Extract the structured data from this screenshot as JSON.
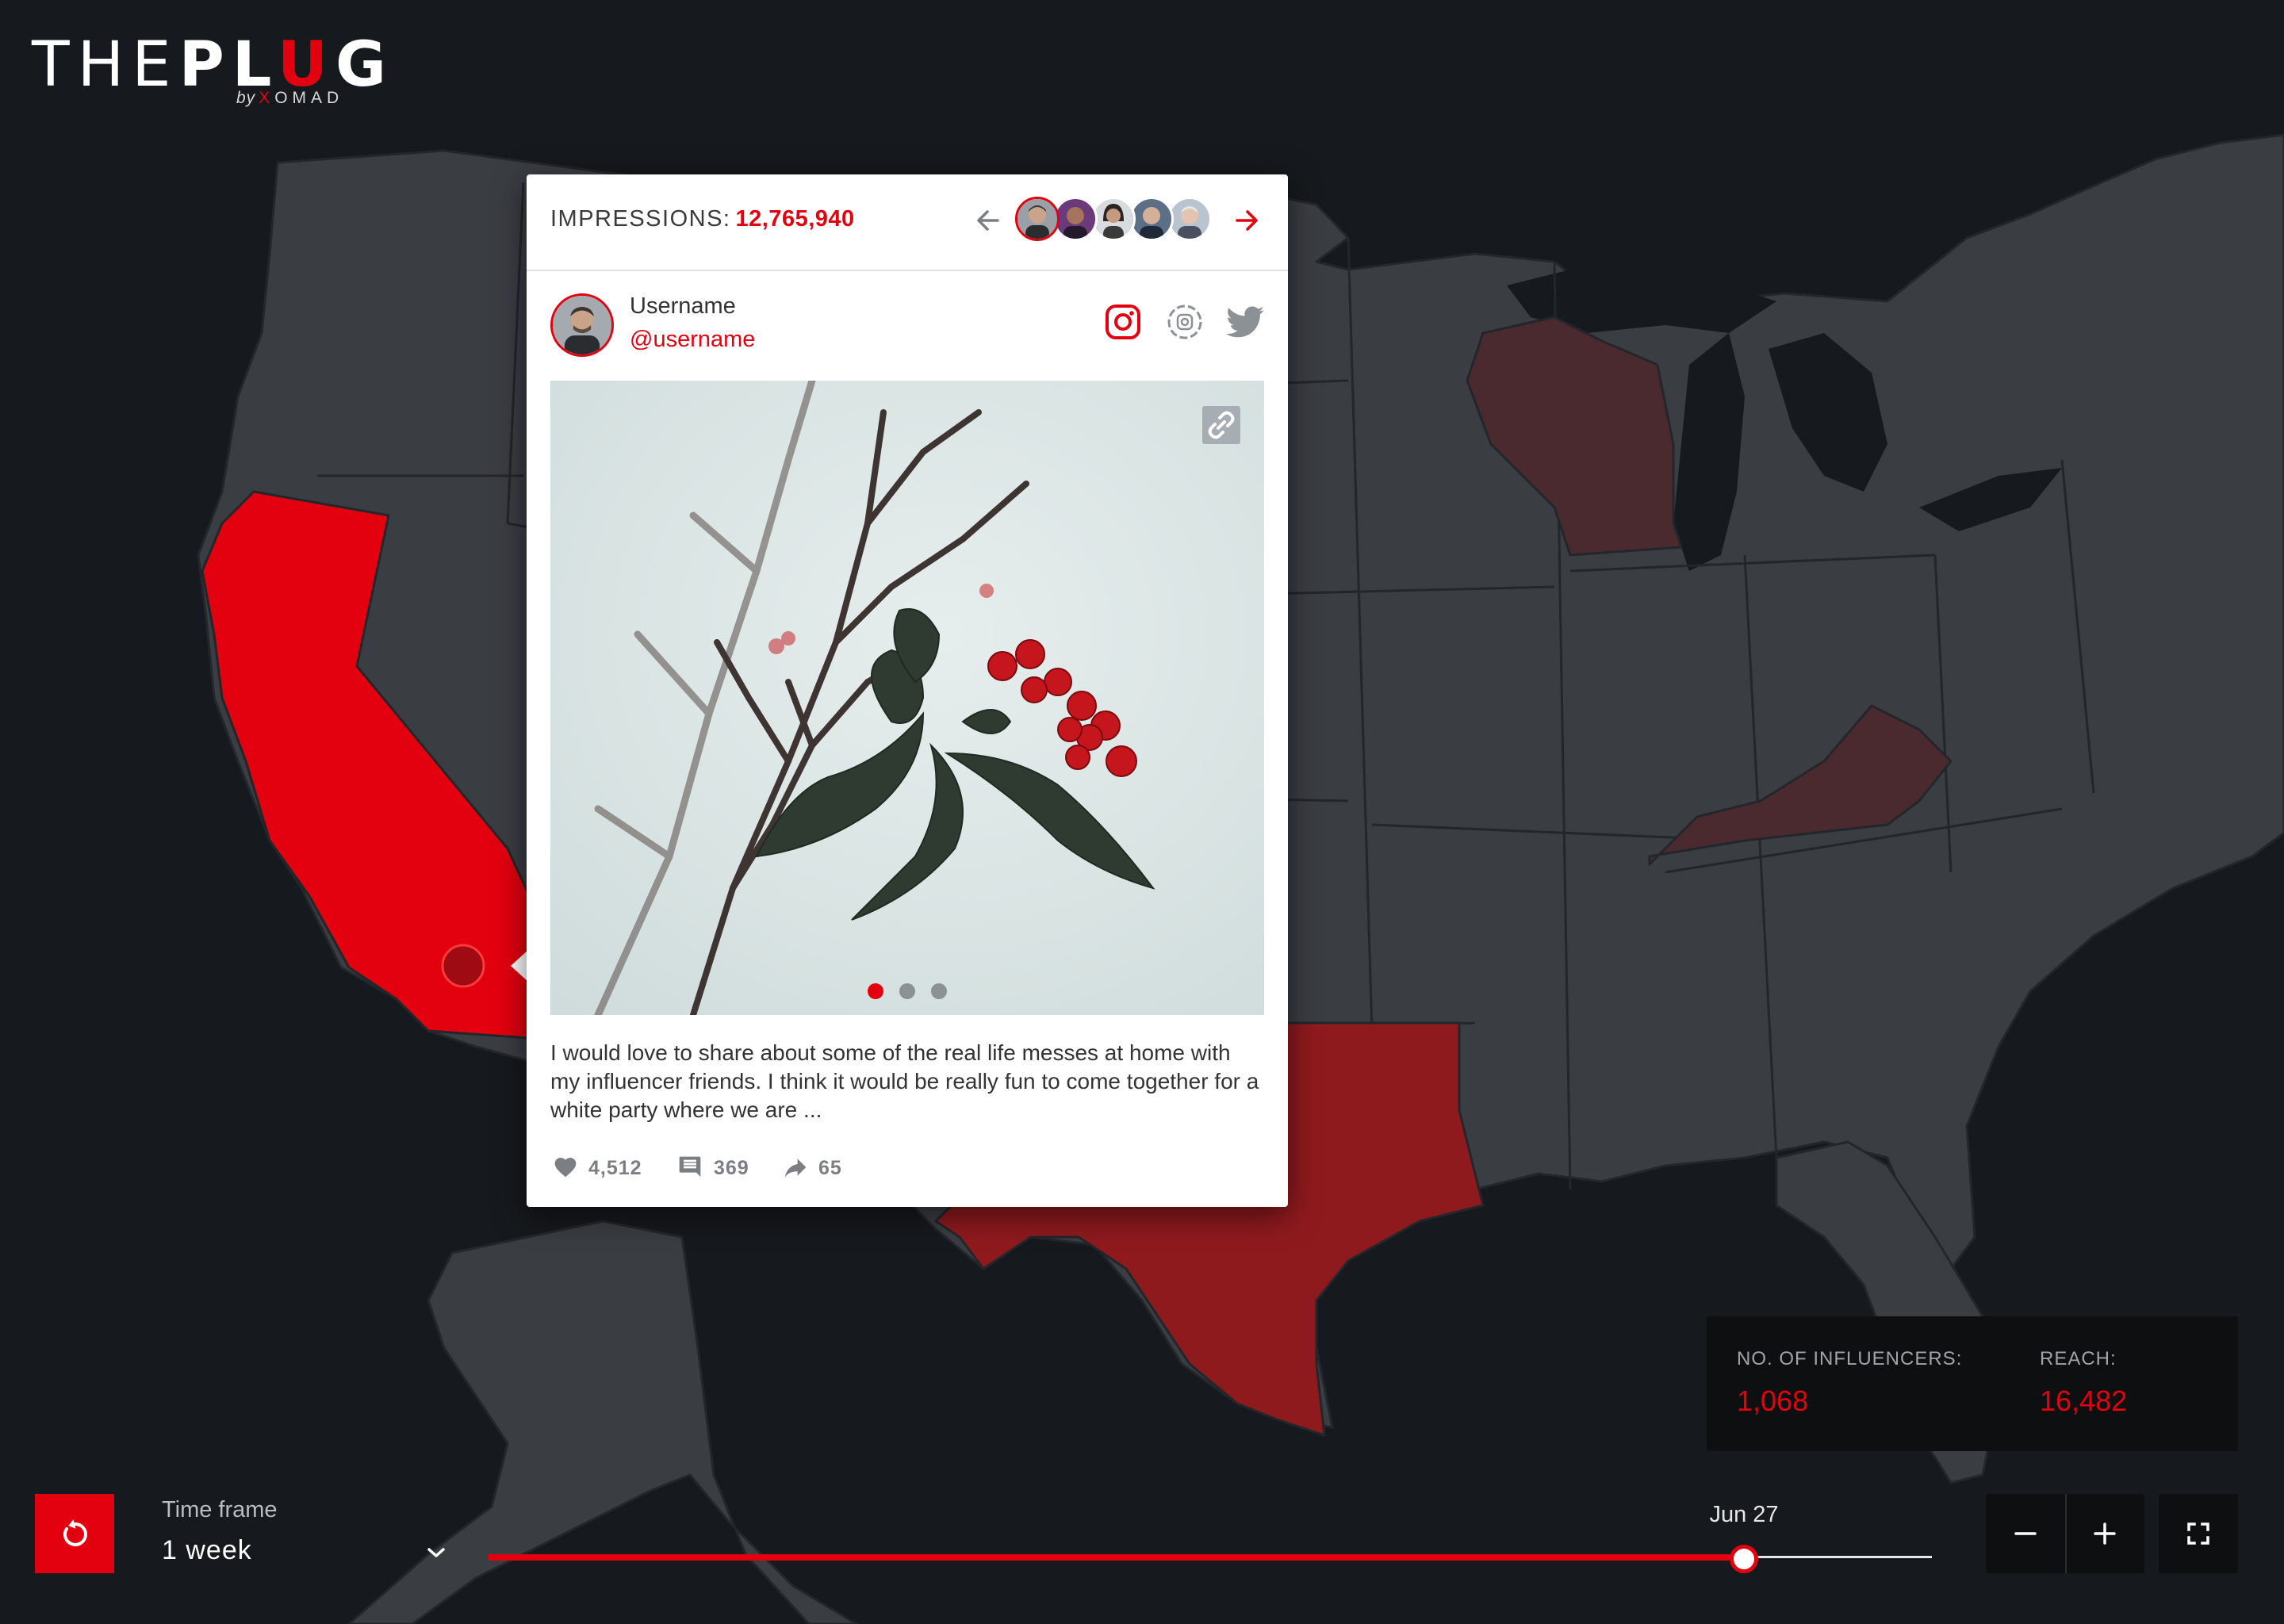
{
  "brand": {
    "logo_the": "THE",
    "logo_pl": "PL",
    "logo_u": "U",
    "logo_g": "G",
    "logo_by": "by",
    "logo_x": "X",
    "logo_omad": "OMAD"
  },
  "map": {
    "highlight_color": "#e3000f",
    "medium_color": "#8f1a1e",
    "light_color": "#4a2a2e",
    "base_color": "#3a3d42",
    "water_color": "#16191d",
    "highlighted_states": [
      {
        "name": "California",
        "level": "high"
      },
      {
        "name": "Texas",
        "level": "medium"
      },
      {
        "name": "Wisconsin",
        "level": "low"
      },
      {
        "name": "Kentucky",
        "level": "low"
      }
    ],
    "selected_marker": "Los Angeles"
  },
  "post_card": {
    "impressions_label": "IMPRESSIONS:",
    "impressions_value": "12,765,940",
    "influencers": [
      "influencer-1",
      "influencer-2",
      "influencer-3",
      "influencer-4",
      "influencer-5"
    ],
    "active_influencer": 0,
    "user": {
      "name": "Username",
      "handle": "@username"
    },
    "social_icons": [
      "instagram-icon",
      "instagram-story-icon",
      "twitter-icon"
    ],
    "image_description_icon": "link-icon",
    "carousel": {
      "count": 3,
      "active": 0
    },
    "caption": "I would love to share about some of the real life messes at home with my influencer friends. I think it would be really fun to come together for a white party where we are ...",
    "likes": "4,512",
    "comments": "369",
    "shares": "65"
  },
  "info_box": {
    "influencers_label": "NO. OF INFLUENCERS:",
    "influencers_value": "1,068",
    "reach_label": "REACH:",
    "reach_value": "16,482"
  },
  "controls": {
    "timeframe_label": "Time frame",
    "timeframe_value": "1 week",
    "timeline_date": "Jun 27",
    "timeline_progress": 0.87
  }
}
